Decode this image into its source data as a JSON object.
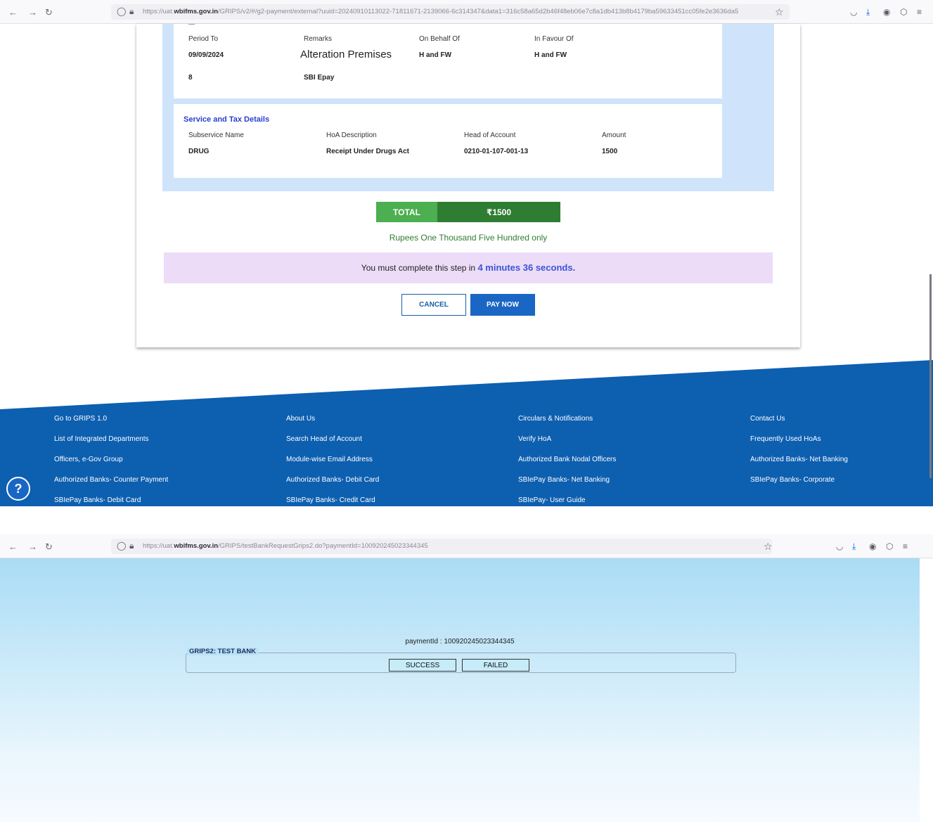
{
  "browser1": {
    "url_prefix": "https://uat.",
    "url_domain": "wbifms.gov.in",
    "url_rest": "/GRIPS/v2/#/g2-payment/external?uuid=20240910113022-71811671-2139066-6c314347&data1=316c58a65d2b46f48eb06e7c8a1db413b8b4179ba59633451cc05fe2e3636da5"
  },
  "form": {
    "row1": {
      "period_to_label": "Period To",
      "period_to_value": "09/09/2024",
      "remarks_label": "Remarks",
      "remarks_value": "Alteration Premises",
      "on_behalf_label": "On Behalf Of",
      "on_behalf_value": "H and FW",
      "in_favour_label": "In Favour Of",
      "in_favour_value": "H and FW"
    },
    "row2": {
      "val1": "8",
      "val2": "SBI Epay"
    },
    "service": {
      "title": "Service and Tax Details",
      "headers": [
        "Subservice Name",
        "HoA Description",
        "Head of Account",
        "Amount"
      ],
      "row": [
        "DRUG",
        "Receipt Under Drugs Act",
        "0210-01-107-001-13",
        "1500"
      ]
    },
    "total_label": "TOTAL",
    "total_value": "₹1500",
    "amount_words": "Rupees One Thousand Five Hundred only",
    "timer_prefix": "You must complete this step in",
    "timer_value": "4 minutes 36 seconds.",
    "cancel_label": "CANCEL",
    "pay_label": "PAY NOW"
  },
  "footer": {
    "col1": [
      "Go to GRIPS 1.0",
      "List of Integrated Departments",
      "Officers, e-Gov Group",
      "Authorized Banks- Counter Payment",
      "SBIePay Banks- Debit Card"
    ],
    "col2": [
      "About Us",
      "Search Head of Account",
      "Module-wise Email Address",
      "Authorized Banks- Debit Card",
      "SBIePay Banks- Credit Card"
    ],
    "col3": [
      "Circulars & Notifications",
      "Verify HoA",
      "Authorized Bank Nodal Officers",
      "SBIePay Banks- Net Banking",
      "SBIePay- User Guide"
    ],
    "col4": [
      "Contact Us",
      "Frequently Used HoAs",
      "Authorized Banks- Net Banking",
      "SBIePay Banks- Corporate"
    ],
    "help_icon": "?",
    "color": "#0d5fb0"
  },
  "browser2": {
    "url_prefix": "https://uat.",
    "url_domain": "wbifms.gov.in",
    "url_rest": "/GRIPS/testBankRequestGrips2.do?paymentId=100920245023344345"
  },
  "bank": {
    "payment_id": "paymentId : 100920245023344345",
    "legend": "GRIPS2: TEST BANK",
    "success_label": "SUCCESS",
    "failed_label": "FAILED"
  }
}
